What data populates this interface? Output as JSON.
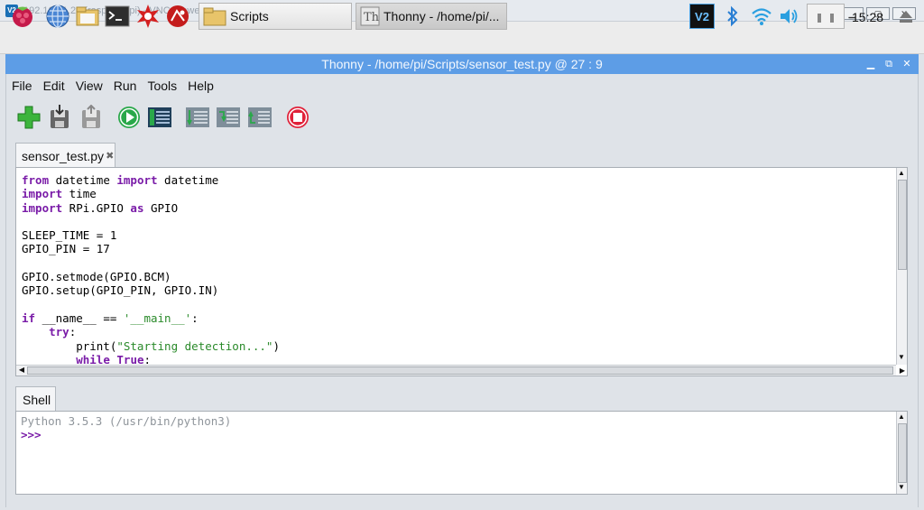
{
  "vnc": {
    "title": "192.168.1.20 (raspberrypi) - VNC Viewer",
    "logo_text": "V2"
  },
  "taskbar": {
    "launchers": [
      {
        "icon": "raspberry-menu-icon"
      },
      {
        "icon": "web-browser-icon"
      },
      {
        "icon": "file-manager-icon"
      },
      {
        "icon": "terminal-icon"
      },
      {
        "icon": "wolfram-icon"
      },
      {
        "icon": "mathematica-icon"
      }
    ],
    "tasks": [
      {
        "label": "Scripts",
        "icon": "folder-icon"
      },
      {
        "label": "Thonny  -  /home/pi/...",
        "icon": "thonny-icon"
      }
    ],
    "clock": "15:28"
  },
  "thonny": {
    "window_title": "Thonny  -  /home/pi/Scripts/sensor_test.py  @  27 : 9",
    "menu": [
      "File",
      "Edit",
      "View",
      "Run",
      "Tools",
      "Help"
    ],
    "toolbar": [
      {
        "name": "new-file-icon"
      },
      {
        "name": "load-file-icon"
      },
      {
        "name": "save-file-icon"
      },
      {
        "name": "run-icon"
      },
      {
        "name": "debug-icon"
      },
      {
        "name": "step-over-icon"
      },
      {
        "name": "step-into-icon"
      },
      {
        "name": "step-out-icon"
      },
      {
        "name": "stop-icon"
      }
    ],
    "editor_tab": {
      "label": "sensor_test.py",
      "close": "✖"
    },
    "code_lines": [
      [
        [
          "kw",
          "from"
        ],
        [
          "t",
          " datetime "
        ],
        [
          "kw",
          "import"
        ],
        [
          "t",
          " datetime"
        ]
      ],
      [
        [
          "kw",
          "import"
        ],
        [
          "t",
          " time"
        ]
      ],
      [
        [
          "kw",
          "import"
        ],
        [
          "t",
          " RPi.GPIO "
        ],
        [
          "kw",
          "as"
        ],
        [
          "t",
          " GPIO"
        ]
      ],
      [
        [
          "t",
          ""
        ]
      ],
      [
        [
          "t",
          "SLEEP_TIME = 1"
        ]
      ],
      [
        [
          "t",
          "GPIO_PIN = 17"
        ]
      ],
      [
        [
          "t",
          ""
        ]
      ],
      [
        [
          "t",
          "GPIO.setmode(GPIO.BCM)"
        ]
      ],
      [
        [
          "t",
          "GPIO.setup(GPIO_PIN, GPIO.IN)"
        ]
      ],
      [
        [
          "t",
          ""
        ]
      ],
      [
        [
          "kw",
          "if"
        ],
        [
          "t",
          " __name__ == "
        ],
        [
          "str",
          "'__main__'"
        ],
        [
          "t",
          ":"
        ]
      ],
      [
        [
          "t",
          "    "
        ],
        [
          "kw",
          "try"
        ],
        [
          "t",
          ":"
        ]
      ],
      [
        [
          "t",
          "        print("
        ],
        [
          "str",
          "\"Starting detection...\""
        ],
        [
          "t",
          ")"
        ]
      ],
      [
        [
          "t",
          "        "
        ],
        [
          "kw",
          "while"
        ],
        [
          "t",
          " "
        ],
        [
          "kw",
          "True"
        ],
        [
          "t",
          ":"
        ]
      ]
    ],
    "shell_tab": "Shell",
    "shell_banner": "Python 3.5.3 (/usr/bin/python3)",
    "shell_prompt": ">>>"
  }
}
